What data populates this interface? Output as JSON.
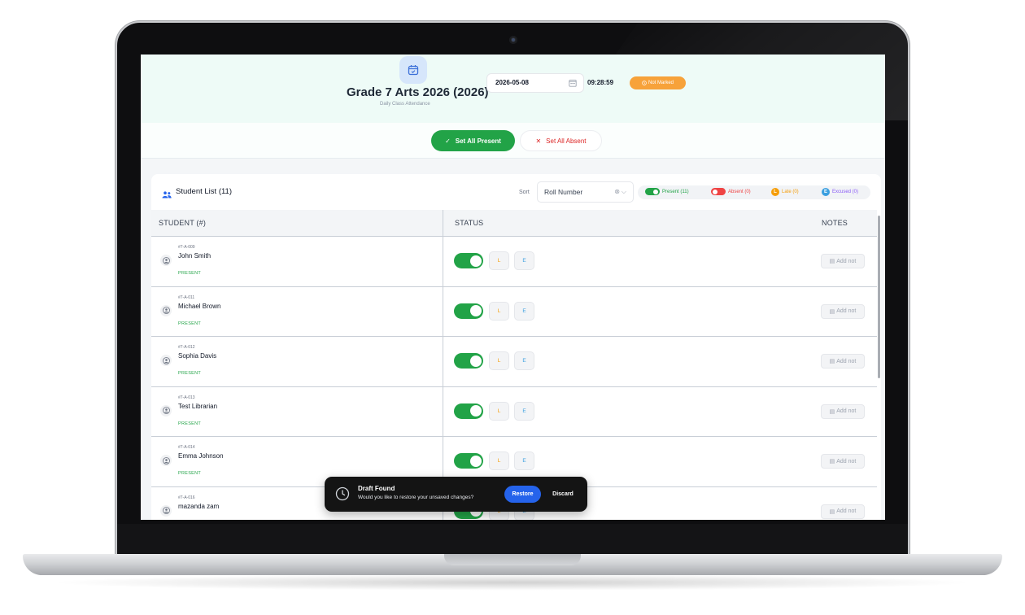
{
  "header": {
    "title": "Grade 7 Arts 2026 (2026)",
    "subtitle": "Daily Class Attendance",
    "date_value": "2026-05-08",
    "time": "09:28:59",
    "status_badge": "Not Marked",
    "icon": "calendar-check-icon"
  },
  "actions": {
    "set_all_present": "Set All Present",
    "set_all_absent": "Set All Absent"
  },
  "list": {
    "title": "Student List",
    "count": "(11)",
    "sort_label": "Sort",
    "sort_value": "Roll Number",
    "legend": {
      "present": "Present (11)",
      "absent": "Absent (0)",
      "late": "Late (0)",
      "excused": "Excused (0)",
      "late_letter": "L",
      "excused_letter": "E"
    }
  },
  "table": {
    "columns": {
      "student": "STUDENT (#)",
      "status": "STATUS",
      "notes": "NOTES"
    },
    "late_label": "L",
    "excused_label": "E",
    "note_label": "Add not",
    "rows": [
      {
        "roll": "#7-A-009",
        "name": "John Smith",
        "status": "PRESENT",
        "present": true
      },
      {
        "roll": "#7-A-011",
        "name": "Michael Brown",
        "status": "PRESENT",
        "present": true
      },
      {
        "roll": "#7-A-012",
        "name": "Sophia Davis",
        "status": "PRESENT",
        "present": true
      },
      {
        "roll": "#7-A-013",
        "name": "Test Librarian",
        "status": "PRESENT",
        "present": true
      },
      {
        "roll": "#7-A-014",
        "name": "Emma Johnson",
        "status": "PRESENT",
        "present": true
      },
      {
        "roll": "#7-A-016",
        "name": "mazanda zam",
        "status": "",
        "present": true
      }
    ]
  },
  "toast": {
    "title": "Draft Found",
    "message": "Would you like to restore your unsaved changes?",
    "restore": "Restore",
    "discard": "Discard",
    "icon": "clock-icon"
  },
  "colors": {
    "present": "#22a347",
    "absent": "#ef4444",
    "late": "#f59e0b",
    "excused": "#3b9fe0",
    "not_marked": "#f7a23a",
    "restore": "#2563eb"
  }
}
